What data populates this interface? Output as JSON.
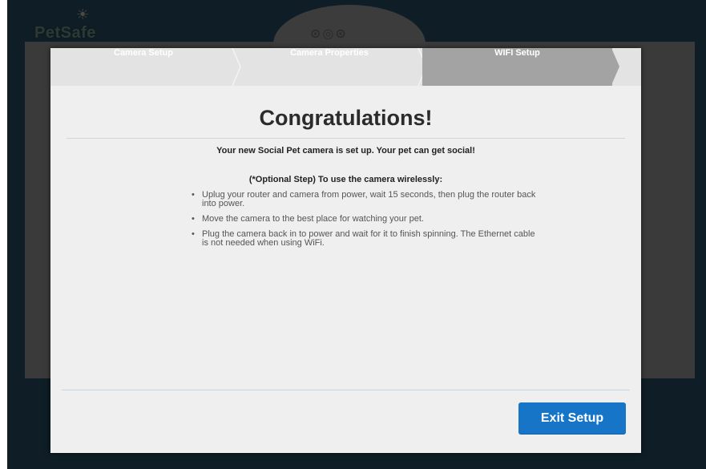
{
  "brand": {
    "logo_text": "PetSafe"
  },
  "steps": [
    {
      "label": "Camera Setup"
    },
    {
      "label": "Camera Properties"
    },
    {
      "label": "WIFI Setup"
    }
  ],
  "active_step": "WIFI Setup",
  "content": {
    "title": "Congratulations!",
    "subtitle": "Your new Social Pet camera is set up. Your pet can get social!",
    "optional_heading": "(*Optional Step) To use the camera wirelessly:",
    "bullets": [
      "Uplug your router and camera from power, wait 15 seconds, then plug the router back into power.",
      "Move the camera to the best place for watching your pet.",
      "Plug the camera back in to power and wait for it to finish spinning. The Ethernet cable is not needed when using WiFi."
    ]
  },
  "footer": {
    "exit_label": "Exit Setup"
  },
  "colors": {
    "background": "#0f1d26",
    "modal": "#efefef",
    "active_step": "#a3a3a3",
    "button": "#1775c8"
  }
}
